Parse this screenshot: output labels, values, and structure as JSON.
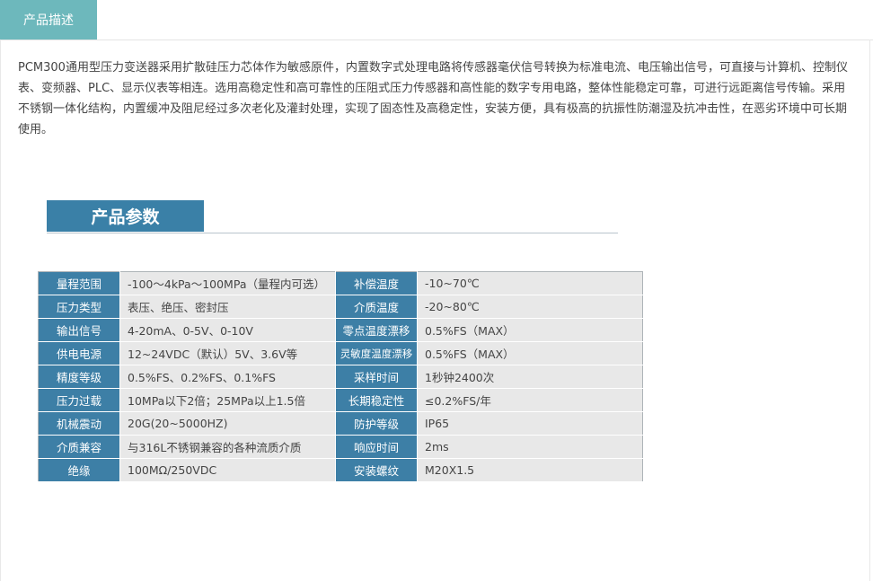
{
  "tabs": [
    {
      "label": "产品描述",
      "active": true
    }
  ],
  "description": "PCM300通用型压力变送器采用扩散硅压力芯体作为敏感原件，内置数字式处理电路将传感器毫伏信号转换为标准电流、电压输出信号，可直接与计算机、控制仪表、变频器、PLC、显示仪表等相连。选用高稳定性和高可靠性的压阻式压力传感器和高性能的数字专用电路，整体性能稳定可靠，可进行远距离信号传输。采用不锈钢一体化结构，内置缓冲及阻尼经过多次老化及灌封处理，实现了固态性及高稳定性，安装方便，具有极高的抗振性防潮湿及抗冲击性，在恶劣环境中可长期使用。",
  "params_section": {
    "title": "产品参数",
    "rows": [
      {
        "k1": "量程范围",
        "v1": "-100～4kPa～100MPa（量程内可选）",
        "k2": "补偿温度",
        "v2": "-10~70℃"
      },
      {
        "k1": "压力类型",
        "v1": "表压、绝压、密封压",
        "k2": "介质温度",
        "v2": "-20~80℃"
      },
      {
        "k1": "输出信号",
        "v1": "4-20mA、0-5V、0-10V",
        "k2": "零点温度漂移",
        "v2": "0.5%FS（MAX）"
      },
      {
        "k1": "供电电源",
        "v1": "12~24VDC（默认）5V、3.6V等",
        "k2": "灵敏度温度漂移",
        "v2": "0.5%FS（MAX）"
      },
      {
        "k1": "精度等级",
        "v1": "0.5%FS、0.2%FS、0.1%FS",
        "k2": "采样时间",
        "v2": "1秒钟2400次"
      },
      {
        "k1": "压力过载",
        "v1": "10MPa以下2倍；25MPa以上1.5倍",
        "k2": "长期稳定性",
        "v2": "≤0.2%FS/年"
      },
      {
        "k1": "机械震动",
        "v1": "20G(20~5000HZ)",
        "k2": "防护等级",
        "v2": "IP65"
      },
      {
        "k1": "介质兼容",
        "v1": "与316L不锈钢兼容的各种流质介质",
        "k2": "响应时间",
        "v2": "2ms"
      },
      {
        "k1": "绝缘",
        "v1": "100MΩ/250VDC",
        "k2": "安装螺纹",
        "v2": "M20X1.5"
      }
    ]
  },
  "colors": {
    "tab_active": "#6db8bc",
    "heading_bg": "#3a80a7",
    "key_cell": "#3d7fa6",
    "value_cell": "#e8e8e8"
  }
}
